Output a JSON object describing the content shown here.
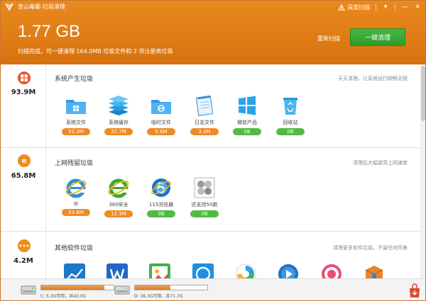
{
  "window": {
    "title": "金山毒霸-垃圾清理"
  },
  "titlebar": {
    "deep_scan_label": "深度扫描"
  },
  "summary": {
    "total_size": "1.77 GB",
    "scan_status": "扫描完成，可一键清理 164.0MB 垃圾文件和 2 项注册表垃圾",
    "rescan_label": "重新扫描",
    "clean_button_label": "一键清理"
  },
  "sections": [
    {
      "title": "系统产生垃圾",
      "size": "93.9M",
      "tip": "天天清理，让系统运行顺畅无阻",
      "icon": "windows-icon",
      "items": [
        {
          "label": "系统文件",
          "size": "52.3M",
          "status": "orange",
          "icon": "folder-windows-icon"
        },
        {
          "label": "系统缓存",
          "size": "32.7M",
          "status": "orange",
          "icon": "stacked-layers-icon"
        },
        {
          "label": "临时文件",
          "size": "5.6M",
          "status": "orange",
          "icon": "folder-ie-icon"
        },
        {
          "label": "日志文件",
          "size": "3.4M",
          "status": "orange",
          "icon": "notepad-icon"
        },
        {
          "label": "微软产品",
          "size": "0B",
          "status": "green",
          "icon": "windows-logo-icon"
        },
        {
          "label": "回收站",
          "size": "0B",
          "status": "green",
          "icon": "recycle-bin-icon"
        }
      ]
    },
    {
      "title": "上网残留垃圾",
      "size": "65.8M",
      "tip": "清理后大幅提高上网速度",
      "icon": "ie-icon",
      "items": [
        {
          "label": "IE",
          "size": "53.6M",
          "status": "orange",
          "icon": "ie-browser-icon"
        },
        {
          "label": "360安全",
          "size": "12.3M",
          "status": "orange",
          "icon": "360-browser-icon"
        },
        {
          "label": "115浏览器",
          "size": "0B",
          "status": "green",
          "icon": "115-browser-icon"
        },
        {
          "label": "还支持50款",
          "size": "0B",
          "status": "green",
          "icon": "more-browsers-icon"
        }
      ]
    },
    {
      "title": "其他软件垃圾",
      "size": "4.2M",
      "tip": "清理更多软件垃圾，不留任何死角",
      "icon": "more-dots-icon",
      "items": [
        {
          "icon": "app-chart-icon"
        },
        {
          "icon": "app-word-icon"
        },
        {
          "icon": "app-picture-icon"
        },
        {
          "icon": "app-qq-browser-icon"
        },
        {
          "icon": "app-circle-icon"
        },
        {
          "icon": "app-player-icon"
        },
        {
          "icon": "app-pink-icon"
        },
        {
          "icon": "app-box-icon"
        }
      ]
    }
  ],
  "drives": [
    {
      "text": "C: 5.3G可用，共40.0G",
      "used_fraction": 0.87
    },
    {
      "text": "D: 36.3G可用，共71.7G",
      "used_fraction": 0.49
    }
  ],
  "colors": {
    "header": "#e07d16",
    "orange_badge": "#ef8a24",
    "green_badge": "#52b944",
    "clean_button": "#3aa938"
  }
}
